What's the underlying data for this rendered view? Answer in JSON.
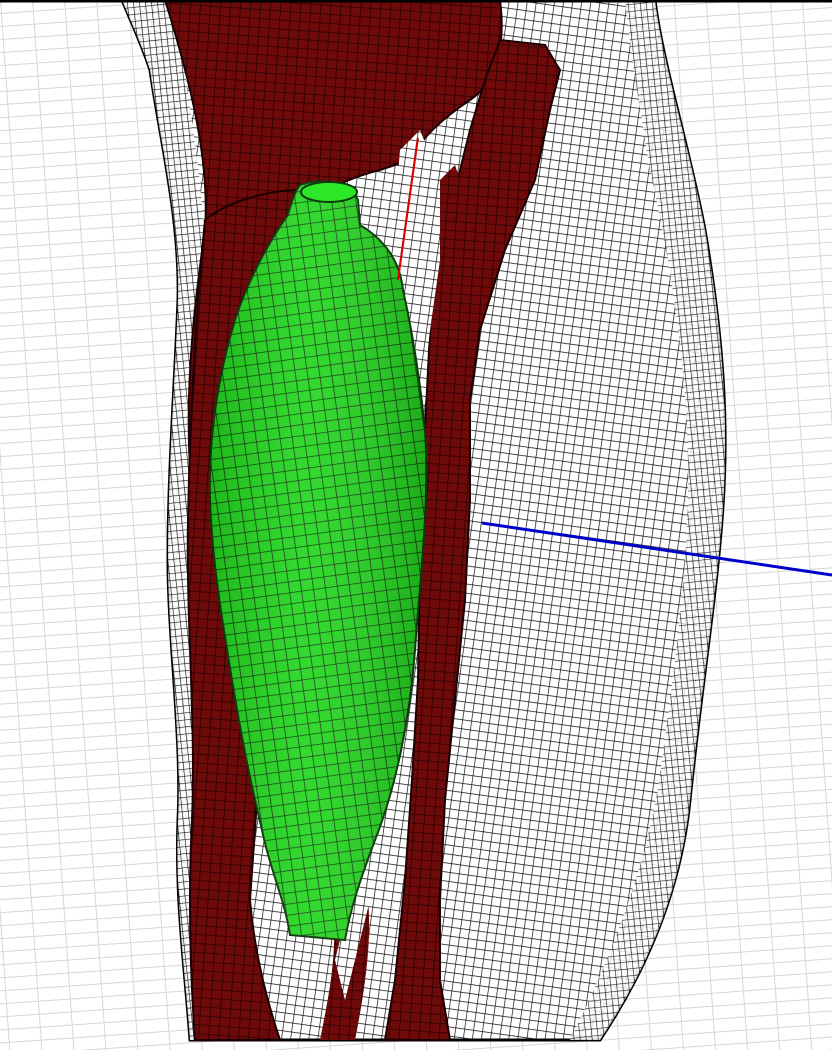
{
  "viewport": {
    "background": "#ffffff",
    "grid_color": "#d6d6d6",
    "view_mode": "wireframe mesh"
  },
  "meshes": [
    {
      "name": "skin-surface",
      "color": "#ffffff",
      "wire_color": "#000000"
    },
    {
      "name": "tissue-structures",
      "color": "#6e0a0a",
      "wire_color": "#1a0000"
    },
    {
      "name": "implant-segment",
      "color": "#22d61e",
      "wire_color": "#0a3a0a"
    }
  ],
  "axes": {
    "blue_axis_color": "#0000cc",
    "red_axis_color": "#e00000"
  }
}
